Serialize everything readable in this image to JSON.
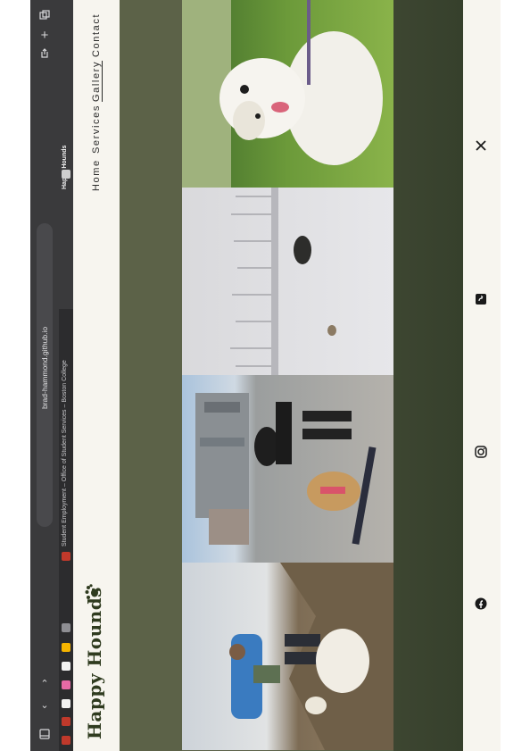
{
  "browser": {
    "url": "brad-hammond.github.io",
    "tab_label": "Student Employment – Office of Student Services – Boston College",
    "tab_site_label": "Happy Hounds"
  },
  "site": {
    "brand": "Happy Hounds",
    "nav": [
      "Home",
      "Services",
      "Gallery",
      "Contact"
    ],
    "active_nav": "Gallery",
    "brand_color": "#2f3b1f",
    "band_color": "#5c6248",
    "footer_band_color": "#3a4330"
  },
  "gallery": {
    "photos": [
      {
        "subject": "golden retriever on grass"
      },
      {
        "subject": "person and small dog on snowy field"
      },
      {
        "subject": "woman skateboarding with dog on city rooftop"
      },
      {
        "subject": "hiker with dog on rocky trail"
      }
    ]
  },
  "footer": {
    "icons": [
      "x-icon",
      "tiktok-icon",
      "instagram-icon",
      "facebook-icon"
    ]
  }
}
